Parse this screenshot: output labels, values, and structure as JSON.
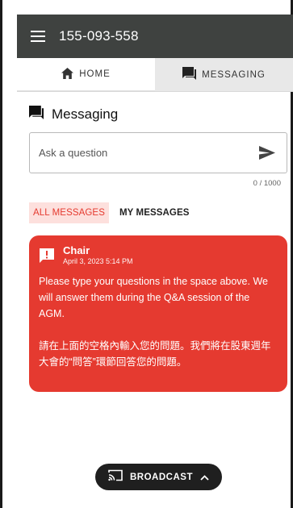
{
  "appbar": {
    "title": "155-093-558",
    "menu_icon": "hamburger-menu-icon"
  },
  "tabs": [
    {
      "label": "HOME",
      "icon": "home-icon",
      "active": false
    },
    {
      "label": "MESSAGING",
      "icon": "chat-icon",
      "active": true
    }
  ],
  "messaging": {
    "heading": "Messaging",
    "input": {
      "placeholder": "Ask a question",
      "value": ""
    },
    "char_count": "0 / 1000",
    "filters": [
      {
        "label": "ALL MESSAGES",
        "active": true
      },
      {
        "label": "MY MESSAGES",
        "active": false
      }
    ],
    "messages": [
      {
        "author": "Chair",
        "date": "April 3, 2023 5:14 PM",
        "body_en": "Please type your questions in the space above.  We will answer them during the Q&A session of the AGM.",
        "body_zh": "請在上面的空格內輸入您的問題。我們將在股東週年大會的“問答”環節回答您的問題。"
      }
    ]
  },
  "broadcast": {
    "label": "BROADCAST"
  },
  "colors": {
    "appbar": "#3f4240",
    "accent": "#e53a30",
    "pill": "#1f1f1f"
  }
}
